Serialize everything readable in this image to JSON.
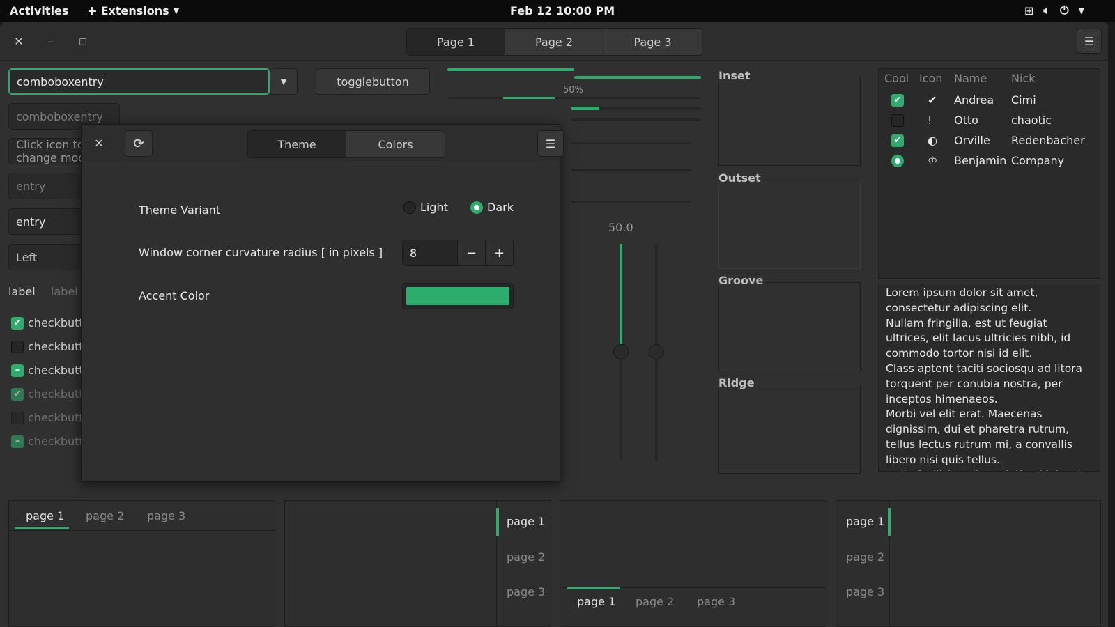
{
  "topbar": {
    "activities": "Activities",
    "extensions": "Extensions",
    "clock": "Feb 12  10:00 PM"
  },
  "headerbar": {
    "pages": [
      "Page 1",
      "Page 2",
      "Page 3"
    ]
  },
  "left": {
    "combo_entry_value": "comboboxentry",
    "combo_entry2_placeholder": "comboboxentry",
    "icon_entry_placeholder": "Click icon to change mode",
    "entry_placeholder": "entry",
    "entry_value": "entry",
    "combo_left": "Left",
    "label1": "label",
    "label2": "label",
    "togglebutton": "togglebutton",
    "checkbuttons": [
      {
        "label": "checkbutton",
        "state": "checked"
      },
      {
        "label": "checkbutton",
        "state": "unchecked"
      },
      {
        "label": "checkbutton",
        "state": "mixed"
      },
      {
        "label": "checkbutton",
        "state": "checked"
      },
      {
        "label": "checkbutton",
        "state": "unchecked"
      },
      {
        "label": "checkbutton",
        "state": "mixed"
      }
    ]
  },
  "progress": {
    "label": "50%",
    "value": 0.5
  },
  "scale": {
    "value_label": "50.0",
    "vertical_level": 0.5
  },
  "frames": [
    "Inset",
    "Outset",
    "Groove",
    "Ridge"
  ],
  "tree": {
    "columns": [
      "Cool",
      "Icon",
      "Name",
      "Nick"
    ],
    "rows": [
      {
        "cool": "checked",
        "icon": "check-circle-icon",
        "icon_glyph": "✔",
        "name": "Andrea",
        "nick": "Cimi"
      },
      {
        "cool": "unchecked",
        "icon": "exclamation-circle-icon",
        "icon_glyph": "!",
        "name": "Otto",
        "nick": "chaotic"
      },
      {
        "cool": "checked",
        "icon": "moon-icon",
        "icon_glyph": "◐",
        "name": "Orville",
        "nick": "Redenbacher"
      },
      {
        "cool": "radio-on",
        "icon": "emblem-icon",
        "icon_glyph": "♔",
        "name": "Benjamin",
        "nick": "Company"
      }
    ]
  },
  "textview": {
    "text": "Lorem ipsum dolor sit amet, consectetur adipiscing elit.\nNullam fringilla, est ut feugiat ultrices, elit lacus ultricies nibh, id commodo tortor nisi id elit.\nClass aptent taciti sociosqu ad litora torquent per conubia nostra, per inceptos himenaeos.\nMorbi vel elit erat. Maecenas dignissim, dui et pharetra rutrum, tellus lectus rutrum mi, a convallis libero nisi quis tellus.\nNulla facilisi. Nullam eleifend lobortis"
  },
  "notebooks": {
    "tabs": [
      "page 1",
      "page 2",
      "page 3"
    ]
  },
  "dialog": {
    "tabs": [
      "Theme",
      "Colors"
    ],
    "theme_variant_label": "Theme Variant",
    "light": "Light",
    "dark": "Dark",
    "selected_variant": "Dark",
    "radius_label": "Window corner curvature radius [ in pixels ]",
    "radius_value": "8",
    "accent_label": "Accent Color",
    "accent_color": "#2eac6d"
  },
  "colors": {
    "accent": "#2eac6d",
    "background": "#303030",
    "topbar": "#0b0b0b"
  }
}
